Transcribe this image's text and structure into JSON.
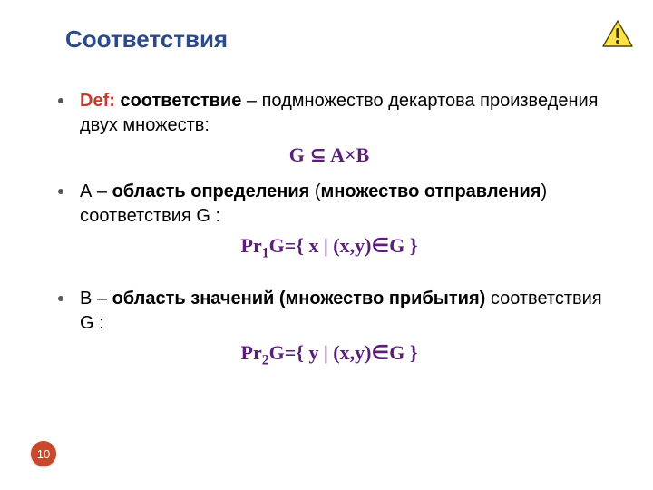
{
  "title": "Соответствия",
  "page_number": "10",
  "items": [
    {
      "def_label": "Def:",
      "term": " соответствие",
      "rest": " – подмножество декартова произведения двух множеств:",
      "formula_parts": {
        "a": "G ",
        "op": "⊆",
        "b": " A×B"
      }
    },
    {
      "plain_before": "А – ",
      "bold": "область определения",
      "plain_mid": " (",
      "bold2": "множество отправления",
      "plain_after": ") соответствия G :",
      "formula_parts": {
        "pr": "Pr",
        "sub": "1",
        "mid": "G={ x | (x,y)",
        "in": "∈",
        "end": "G }"
      }
    },
    {
      "plain_before": "В – ",
      "bold": "область значений (множество прибытия)",
      "plain_after": " соответствия G :",
      "formula_parts": {
        "pr": "Pr",
        "sub": "2",
        "mid": "G={ y | (x,y)",
        "in": "∈",
        "end": "G }"
      }
    }
  ]
}
